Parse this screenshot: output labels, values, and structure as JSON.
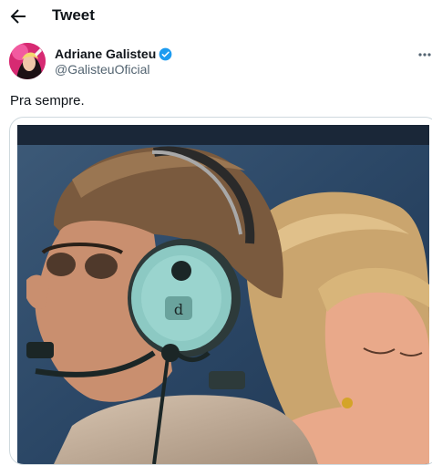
{
  "header": {
    "title": "Tweet",
    "back_icon": "back-arrow-icon"
  },
  "author": {
    "name": "Adriane Galisteu",
    "handle": "@GalisteuOficial",
    "verified": true,
    "avatar_color": "#e8327d"
  },
  "tweet": {
    "text": "Pra sempre."
  },
  "colors": {
    "verified": "#1d9bf0",
    "secondary_text": "#536471",
    "border": "#cfd9de"
  }
}
